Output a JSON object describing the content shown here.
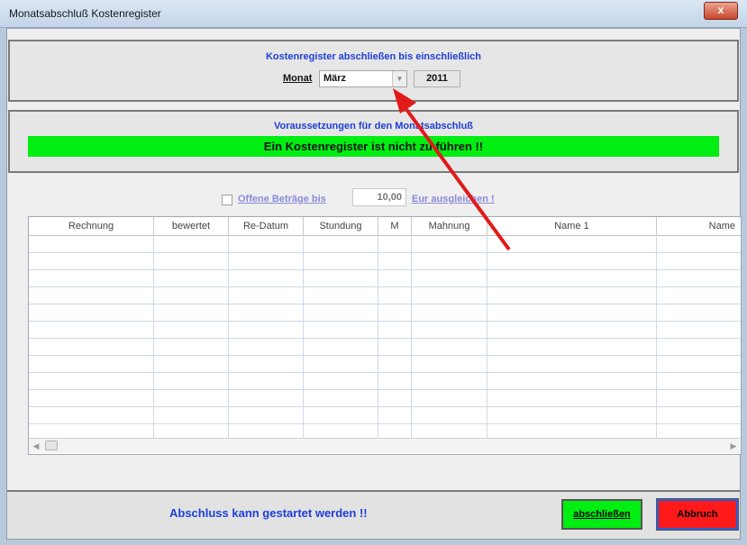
{
  "window": {
    "title": "Monatsabschluß Kostenregister",
    "close_label": "x"
  },
  "period": {
    "heading": "Kostenregister abschließen bis einschließlich",
    "month_label": "Monat",
    "month_value": "März",
    "year": "2011"
  },
  "prereq": {
    "heading": "Voraussetzungen für den Monatsabschluß",
    "message": "Ein Kostenregister ist nicht zu führen !!"
  },
  "options": {
    "offene_label": "Offene Beträge bis",
    "amount": "10,00",
    "suffix": "Eur ausgleichen !"
  },
  "table": {
    "columns": [
      "Rechnung",
      "bewertet",
      "Re-Datum",
      "Stundung",
      "M",
      "Mahnung",
      "Name 1",
      "Name"
    ],
    "rows": []
  },
  "status": {
    "message": "Abschluss kann gestartet werden !!"
  },
  "buttons": {
    "ok": "abschließen",
    "cancel": "Abbruch"
  },
  "colors": {
    "green": "#00ee11",
    "red": "#ff1a1a",
    "blue_text": "#1f3ed6",
    "annotation_arrow": "#e11a1a"
  }
}
